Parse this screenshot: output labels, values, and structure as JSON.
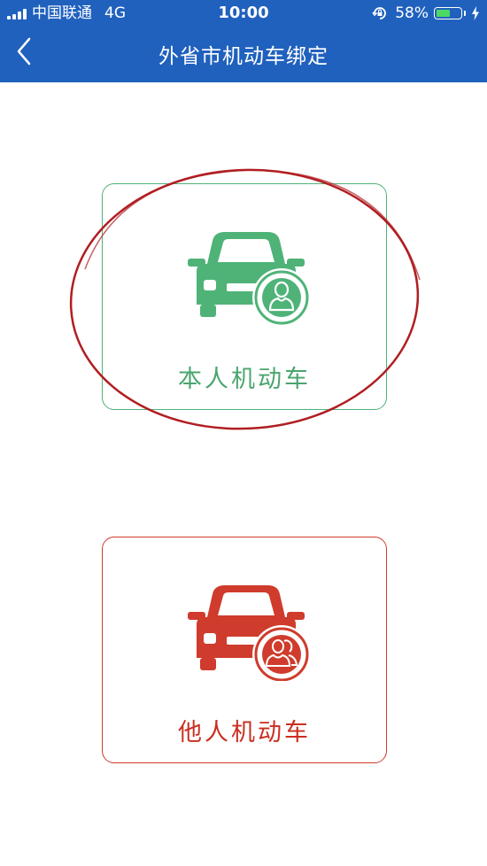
{
  "status_bar": {
    "carrier": "中国联通",
    "network": "4G",
    "time": "10:00",
    "battery": "58%",
    "battery_level": 0.58
  },
  "nav": {
    "back_icon": "chevron-left-icon",
    "title": "外省市机动车绑定"
  },
  "options": {
    "self": {
      "label": "本人机动车",
      "icon": "car-single-user-icon",
      "color": "#4fb378"
    },
    "other": {
      "label": "他人机动车",
      "icon": "car-multi-user-icon",
      "color": "#cf3b2c"
    }
  },
  "colors": {
    "header": "#2061be",
    "annotation": "#b01e22"
  }
}
